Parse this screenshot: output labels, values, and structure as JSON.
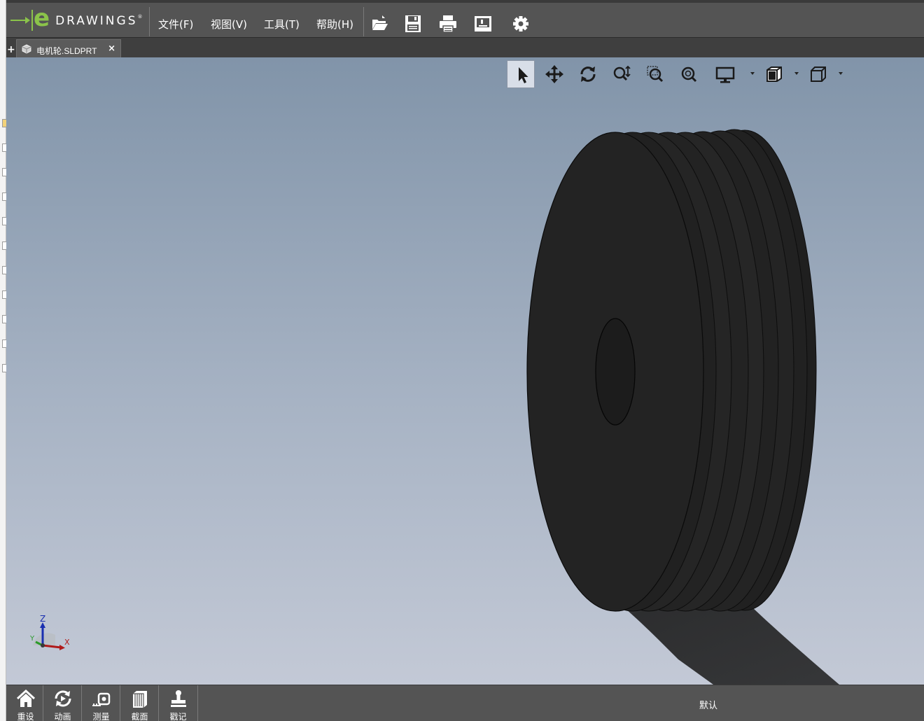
{
  "app": {
    "logo_text": "DRAWINGS",
    "logo_letter": "e",
    "logo_mark": "®",
    "accent_color": "#8bc34a"
  },
  "menu": {
    "file": "文件(F)",
    "view": "视图(V)",
    "tools": "工具(T)",
    "help": "帮助(H)"
  },
  "toolbar": {
    "icons": [
      "open-icon",
      "save-icon",
      "print-icon",
      "publish-icon",
      "settings-icon"
    ]
  },
  "tabs": {
    "new_tab_label": "+",
    "active_tab_label": "电机轮.SLDPRT",
    "close_label": "×"
  },
  "hud": {
    "icons": [
      "select-icon",
      "pan-icon",
      "rotate-icon",
      "zoom-in-out-icon",
      "zoom-area-icon",
      "zoom-fit-icon",
      "display-style-icon",
      "view-settings-icon",
      "view-orientation-icon"
    ]
  },
  "triad": {
    "z_label": "Z",
    "y_label": "Y",
    "x_label": "X"
  },
  "bottom": {
    "reset": "重设",
    "animate": "动画",
    "measure": "测量",
    "section": "截面",
    "stamp": "戳记",
    "configuration": "默认"
  },
  "model": {
    "color": "#1f1f1f"
  }
}
